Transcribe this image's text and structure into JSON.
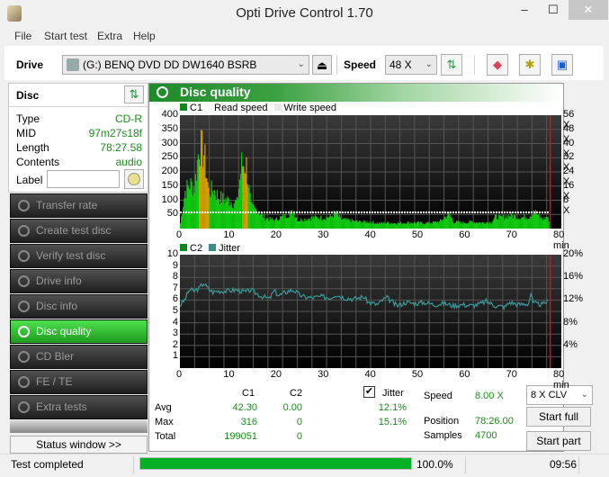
{
  "window": {
    "title": "Opti Drive Control 1.70",
    "minimize": "‒",
    "maximize": "☐",
    "close": "✕"
  },
  "menu": [
    "File",
    "Start test",
    "Extra",
    "Help"
  ],
  "toolbar": {
    "drive_label": "Drive",
    "drive_value": "(G:)  BENQ DVD DD DW1640 BSRB",
    "speed_label": "Speed",
    "speed_value": "48 X"
  },
  "disc": {
    "title": "Disc",
    "rows": [
      {
        "label": "Type",
        "value": "CD-R"
      },
      {
        "label": "MID",
        "value": "97m27s18f"
      },
      {
        "label": "Length",
        "value": "78:27.58"
      },
      {
        "label": "Contents",
        "value": "audio"
      }
    ],
    "label_field_label": "Label",
    "label_field_value": ""
  },
  "nav": [
    {
      "label": "Transfer rate",
      "active": false
    },
    {
      "label": "Create test disc",
      "active": false
    },
    {
      "label": "Verify test disc",
      "active": false
    },
    {
      "label": "Drive info",
      "active": false
    },
    {
      "label": "Disc info",
      "active": false
    },
    {
      "label": "Disc quality",
      "active": true
    },
    {
      "label": "CD Bler",
      "active": false
    },
    {
      "label": "FE / TE",
      "active": false
    },
    {
      "label": "Extra tests",
      "active": false
    }
  ],
  "status_window_button": "Status window >>",
  "panel_title": "Disc quality",
  "chart_data": [
    {
      "type": "bar",
      "title": "C1 / Read speed",
      "legend": [
        "C1",
        "Read speed",
        "Write speed"
      ],
      "x_ticks": [
        "0",
        "10",
        "20",
        "30",
        "40",
        "50",
        "60",
        "70",
        "80 min"
      ],
      "y_ticks": [
        "400",
        "350",
        "300",
        "250",
        "200",
        "150",
        "100",
        "50"
      ],
      "y2_ticks": [
        "56 X",
        "48 X",
        "40 X",
        "32 X",
        "24 X",
        "16 X",
        "8 X"
      ],
      "xlim": [
        0,
        80
      ],
      "ylim": [
        0,
        400
      ],
      "y2lim": [
        0,
        56
      ],
      "read_speed_x": 8,
      "end_marker_min": 78.4,
      "c1_profile": [
        [
          0,
          20
        ],
        [
          1,
          140
        ],
        [
          2,
          165
        ],
        [
          3,
          155
        ],
        [
          4,
          310
        ],
        [
          5,
          280
        ],
        [
          6,
          140
        ],
        [
          7,
          145
        ],
        [
          8,
          120
        ],
        [
          9,
          110
        ],
        [
          10,
          105
        ],
        [
          11,
          100
        ],
        [
          12,
          95
        ],
        [
          13,
          240
        ],
        [
          14,
          235
        ],
        [
          15,
          80
        ],
        [
          16,
          70
        ],
        [
          17,
          55
        ],
        [
          18,
          40
        ],
        [
          19,
          35
        ],
        [
          20,
          30
        ],
        [
          21,
          40
        ],
        [
          22,
          45
        ],
        [
          23,
          55
        ],
        [
          24,
          60
        ],
        [
          25,
          30
        ],
        [
          26,
          35
        ],
        [
          28,
          40
        ],
        [
          30,
          40
        ],
        [
          32,
          45
        ],
        [
          33,
          60
        ],
        [
          34,
          35
        ],
        [
          36,
          30
        ],
        [
          38,
          25
        ],
        [
          40,
          25
        ],
        [
          42,
          20
        ],
        [
          44,
          22
        ],
        [
          46,
          20
        ],
        [
          48,
          22
        ],
        [
          50,
          22
        ],
        [
          52,
          20
        ],
        [
          55,
          25
        ],
        [
          57,
          55
        ],
        [
          58,
          25
        ],
        [
          60,
          22
        ],
        [
          62,
          25
        ],
        [
          64,
          22
        ],
        [
          66,
          25
        ],
        [
          67,
          45
        ],
        [
          68,
          40
        ],
        [
          70,
          50
        ],
        [
          72,
          40
        ],
        [
          74,
          45
        ],
        [
          75,
          70
        ],
        [
          76,
          45
        ],
        [
          77,
          35
        ],
        [
          78,
          45
        ],
        [
          78.4,
          0
        ]
      ],
      "highlight_min": [
        4,
        5,
        13
      ]
    },
    {
      "type": "line",
      "title": "C2 / Jitter",
      "legend": [
        "C2",
        "Jitter"
      ],
      "x_ticks": [
        "0",
        "10",
        "20",
        "30",
        "40",
        "50",
        "60",
        "70",
        "80 min"
      ],
      "y_ticks": [
        "10",
        "9",
        "8",
        "7",
        "6",
        "5",
        "4",
        "3",
        "2",
        "1"
      ],
      "y2_ticks": [
        "20%",
        "16%",
        "12%",
        "8%",
        "4%"
      ],
      "xlim": [
        0,
        80
      ],
      "ylim": [
        0,
        10
      ],
      "y2lim": [
        0,
        20
      ],
      "c2_values": "all 0",
      "jitter_percent": [
        [
          0,
          11
        ],
        [
          1,
          12
        ],
        [
          2,
          13.8
        ],
        [
          3,
          13.6
        ],
        [
          4,
          14
        ],
        [
          5,
          15
        ],
        [
          6,
          14
        ],
        [
          7,
          13.4
        ],
        [
          8,
          13.6
        ],
        [
          10,
          13.6
        ],
        [
          12,
          13.8
        ],
        [
          14,
          13.4
        ],
        [
          15,
          13.8
        ],
        [
          17,
          12.8
        ],
        [
          19,
          12.2
        ],
        [
          20,
          13.6
        ],
        [
          21,
          12.8
        ],
        [
          23,
          13.6
        ],
        [
          24,
          13.8
        ],
        [
          26,
          12.6
        ],
        [
          28,
          12.4
        ],
        [
          30,
          12.6
        ],
        [
          32,
          12.4
        ],
        [
          33,
          13
        ],
        [
          35,
          12.4
        ],
        [
          37,
          12.2
        ],
        [
          39,
          12.6
        ],
        [
          40,
          11.6
        ],
        [
          42,
          11.2
        ],
        [
          43,
          12
        ],
        [
          44,
          12.4
        ],
        [
          46,
          11
        ],
        [
          48,
          11.6
        ],
        [
          50,
          11.4
        ],
        [
          52,
          11.6
        ],
        [
          54,
          11.2
        ],
        [
          56,
          11.4
        ],
        [
          58,
          11
        ],
        [
          60,
          11.2
        ],
        [
          62,
          11
        ],
        [
          64,
          11.4
        ],
        [
          65,
          11.8
        ],
        [
          67,
          11
        ],
        [
          69,
          10.8
        ],
        [
          70,
          11.6
        ],
        [
          72,
          11.2
        ],
        [
          74,
          11.4
        ],
        [
          74.5,
          13.2
        ],
        [
          75,
          11.4
        ],
        [
          77,
          11.2
        ],
        [
          78,
          11.8
        ]
      ]
    }
  ],
  "stats": {
    "col_c1": "C1",
    "col_c2": "C2",
    "jitter_label": "Jitter",
    "jitter_checked": true,
    "rows": [
      {
        "label": "Avg",
        "c1": "42.30",
        "c2": "0.00",
        "jitter": "12.1%"
      },
      {
        "label": "Max",
        "c1": "316",
        "c2": "0",
        "jitter": "15.1%"
      },
      {
        "label": "Total",
        "c1": "199051",
        "c2": "0",
        "jitter": ""
      }
    ],
    "speed_label": "Speed",
    "speed_value": "8.00 X",
    "position_label": "Position",
    "position_value": "78:26.00",
    "samples_label": "Samples",
    "samples_value": "4700",
    "speed_mode": "8 X CLV",
    "start_full": "Start full",
    "start_part": "Start part"
  },
  "status": {
    "text": "Test completed",
    "progress_percent": 100,
    "progress_label": "100.0%",
    "time": "09:56"
  }
}
